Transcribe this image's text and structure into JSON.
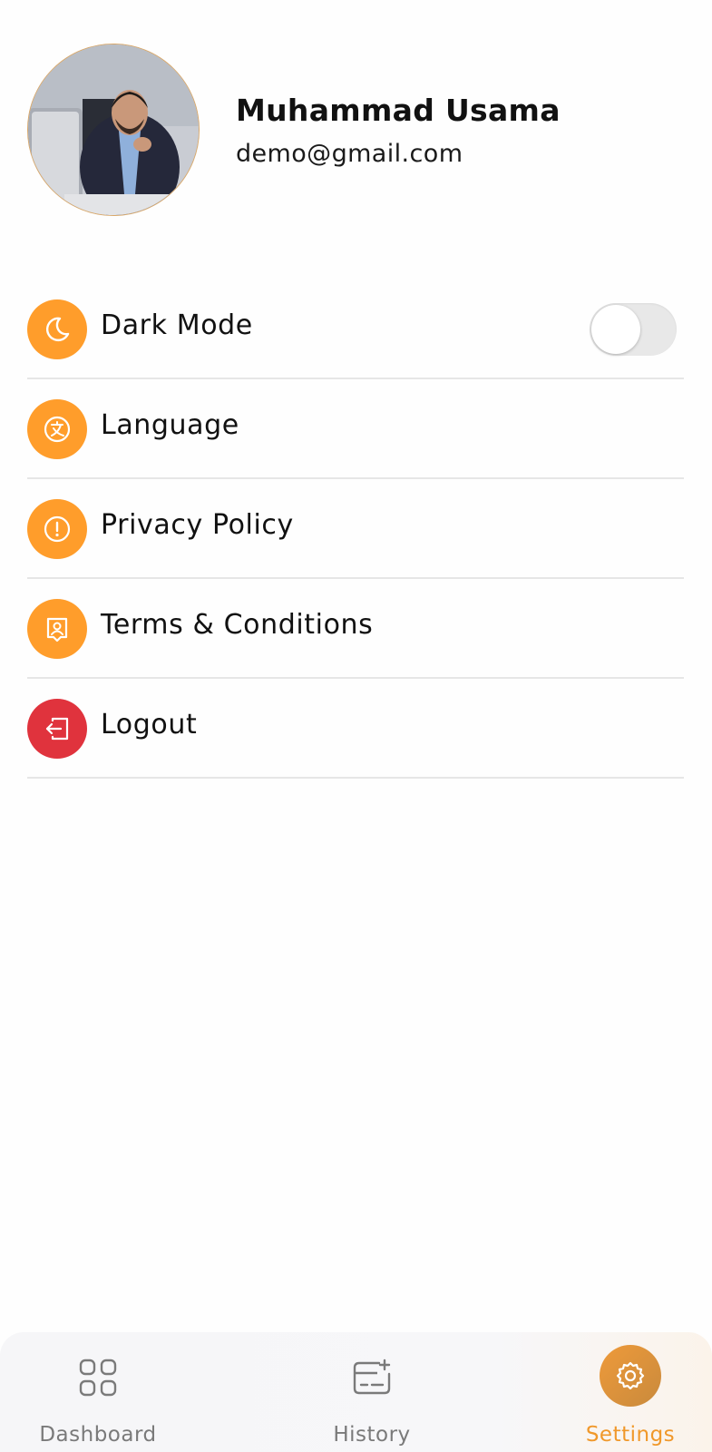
{
  "profile": {
    "name": "Muhammad Usama",
    "email": "demo@gmail.com"
  },
  "settings": {
    "items": [
      {
        "label": "Dark Mode",
        "icon": "moon-icon",
        "has_toggle": true,
        "toggle_on": false
      },
      {
        "label": "Language",
        "icon": "translate-icon"
      },
      {
        "label": "Privacy Policy",
        "icon": "info-alert-icon"
      },
      {
        "label": "Terms & Conditions",
        "icon": "user-document-icon"
      },
      {
        "label": "Logout",
        "icon": "logout-icon"
      }
    ]
  },
  "bottom_nav": {
    "items": [
      {
        "label": "Dashboard",
        "icon": "grid-icon",
        "active": false
      },
      {
        "label": "History",
        "icon": "history-card-icon",
        "active": false
      },
      {
        "label": "Settings",
        "icon": "gear-icon",
        "active": true
      }
    ]
  },
  "colors": {
    "accent": "#ff9d2b",
    "logout": "#e0333d",
    "nav_active": "#f0982a",
    "nav_inactive": "#7a7a7a"
  }
}
